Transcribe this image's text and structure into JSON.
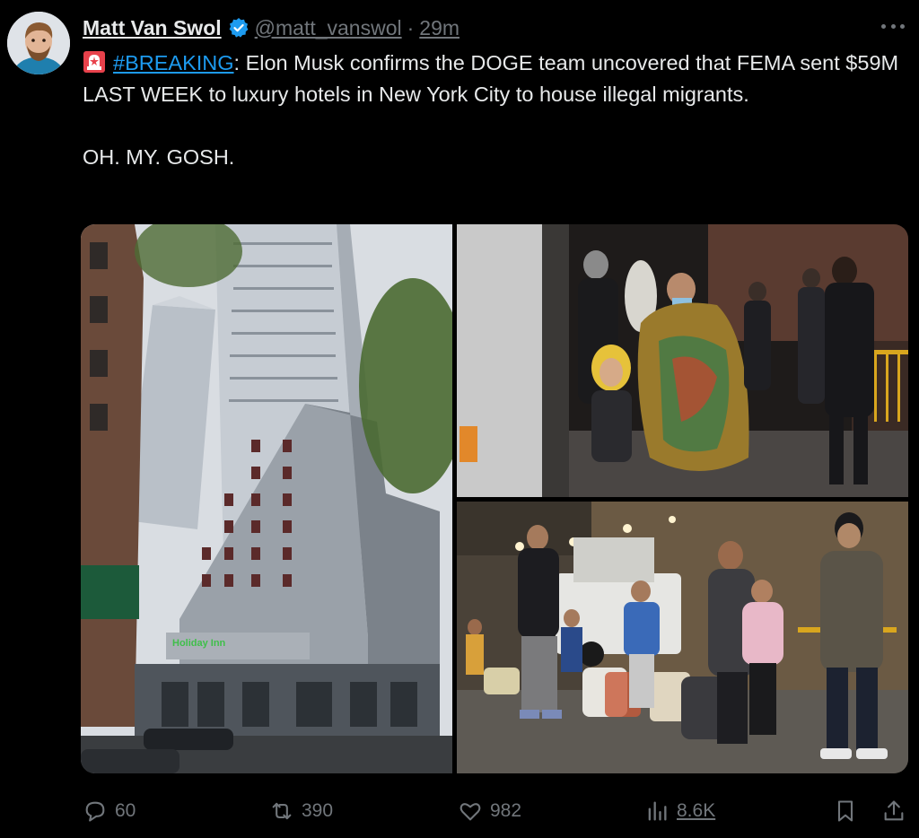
{
  "author": {
    "name": "Matt Van Swol",
    "handle": "@matt_vanswol",
    "separator": "·",
    "time": "29m"
  },
  "tweet": {
    "hashtag": "#BREAKING",
    "body": ": Elon Musk confirms the DOGE team uncovered that FEMA sent $59M LAST WEEK to luxury hotels in New York City to house illegal migrants.",
    "line2": "OH. MY. GOSH."
  },
  "media": {
    "hotel_sign": "Holiday Inn"
  },
  "actions": {
    "replies": "60",
    "reposts": "390",
    "likes": "982",
    "views": "8.6K"
  },
  "colors": {
    "background": "#000000",
    "text": "#e7e9ea",
    "muted": "#71767b",
    "link": "#1d9bf0",
    "verified": "#1d9bf0"
  },
  "icons": [
    "siren-emoji-icon",
    "verified-badge-icon",
    "more-icon",
    "reply-icon",
    "repost-icon",
    "like-icon",
    "views-icon",
    "bookmark-icon",
    "share-icon"
  ]
}
